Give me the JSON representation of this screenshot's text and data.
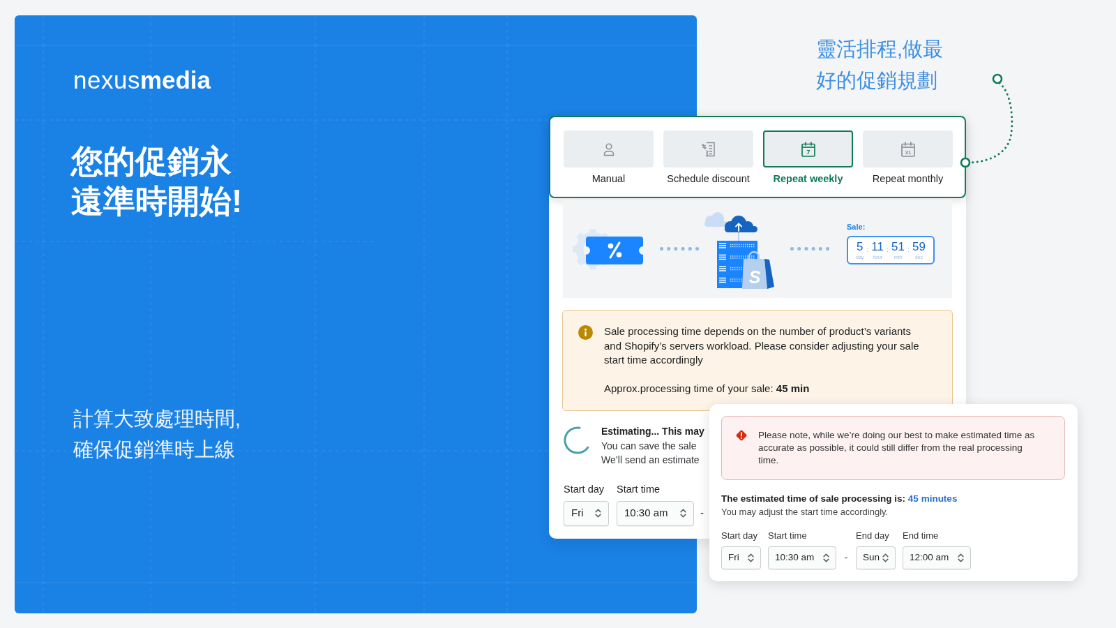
{
  "brand": {
    "light": "nexus",
    "bold": "media"
  },
  "hero": {
    "title_lines": [
      "您的促銷永",
      "遠準時開始!"
    ],
    "subtitle_lines": [
      "計算大致處理時間,",
      "確保促銷準時上線"
    ]
  },
  "callout": {
    "lines": [
      "靈活排程,做最",
      "好的促銷規劃"
    ]
  },
  "tabs": [
    {
      "label": "Manual",
      "selected": false
    },
    {
      "label": "Schedule discount",
      "selected": false
    },
    {
      "label": "Repeat weekly",
      "selected": true,
      "icon_text": "7"
    },
    {
      "label": "Repeat monthly",
      "selected": false,
      "icon_text": "31"
    }
  ],
  "illustration": {
    "bag_mark": "S",
    "countdown": {
      "label": "Sale:",
      "separator": ":",
      "units": [
        {
          "value": "5",
          "unit": "day"
        },
        {
          "value": "11",
          "unit": "hour"
        },
        {
          "value": "51",
          "unit": "min"
        },
        {
          "value": "59",
          "unit": "sec"
        }
      ]
    }
  },
  "warning": {
    "text": "Sale processing time depends on the number of product’s variants and Shopify’s servers workload. Please consider adjusting your sale start time accordingly",
    "approx": "Approx.processing time of your sale: **45 min**"
  },
  "estimating": {
    "title": "Estimating... This may",
    "lines": [
      "You can save the sale",
      "We’ll send an estimate"
    ]
  },
  "schedule": {
    "start": [
      {
        "label": "Start day",
        "value": "Fri"
      },
      {
        "label": "Start time",
        "value": "10:30 am"
      }
    ],
    "separator": "-"
  },
  "popup": {
    "note": "Please note, while we’re doing our best to make estimated time as accurate as possible, it could still differ from the real processing time.",
    "estimate": {
      "lead": "The estimated time of sale processing is:",
      "value": "45 minutes"
    },
    "hint": "You may adjust the start time accordingly.",
    "schedule": {
      "start": [
        {
          "label": "Start day",
          "value": "Fri"
        },
        {
          "label": "Start time",
          "value": "10:30 am"
        }
      ],
      "separator": "-",
      "end": [
        {
          "label": "End day",
          "value": "Sun"
        },
        {
          "label": "End time",
          "value": "12:00 am"
        }
      ]
    }
  }
}
